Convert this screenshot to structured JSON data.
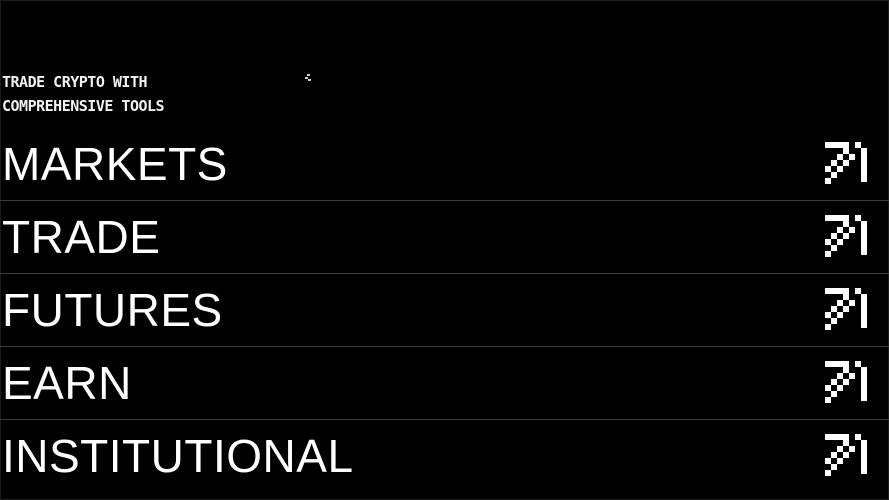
{
  "hero": {
    "tagline_line1": "TRADE CRYPTO WITH",
    "tagline_line2": "COMPREHENSIVE TOOLS"
  },
  "nav": {
    "items": [
      {
        "label": "MARKETS",
        "icon": "arrow-up-right-icon"
      },
      {
        "label": "TRADE",
        "icon": "arrow-up-right-icon"
      },
      {
        "label": "FUTURES",
        "icon": "arrow-up-right-icon"
      },
      {
        "label": "EARN",
        "icon": "arrow-up-right-icon"
      },
      {
        "label": "INSTITUTIONAL",
        "icon": "arrow-up-right-icon"
      }
    ]
  },
  "colors": {
    "background": "#000000",
    "text": "#ffffff",
    "divider": "#3a3a3a"
  }
}
